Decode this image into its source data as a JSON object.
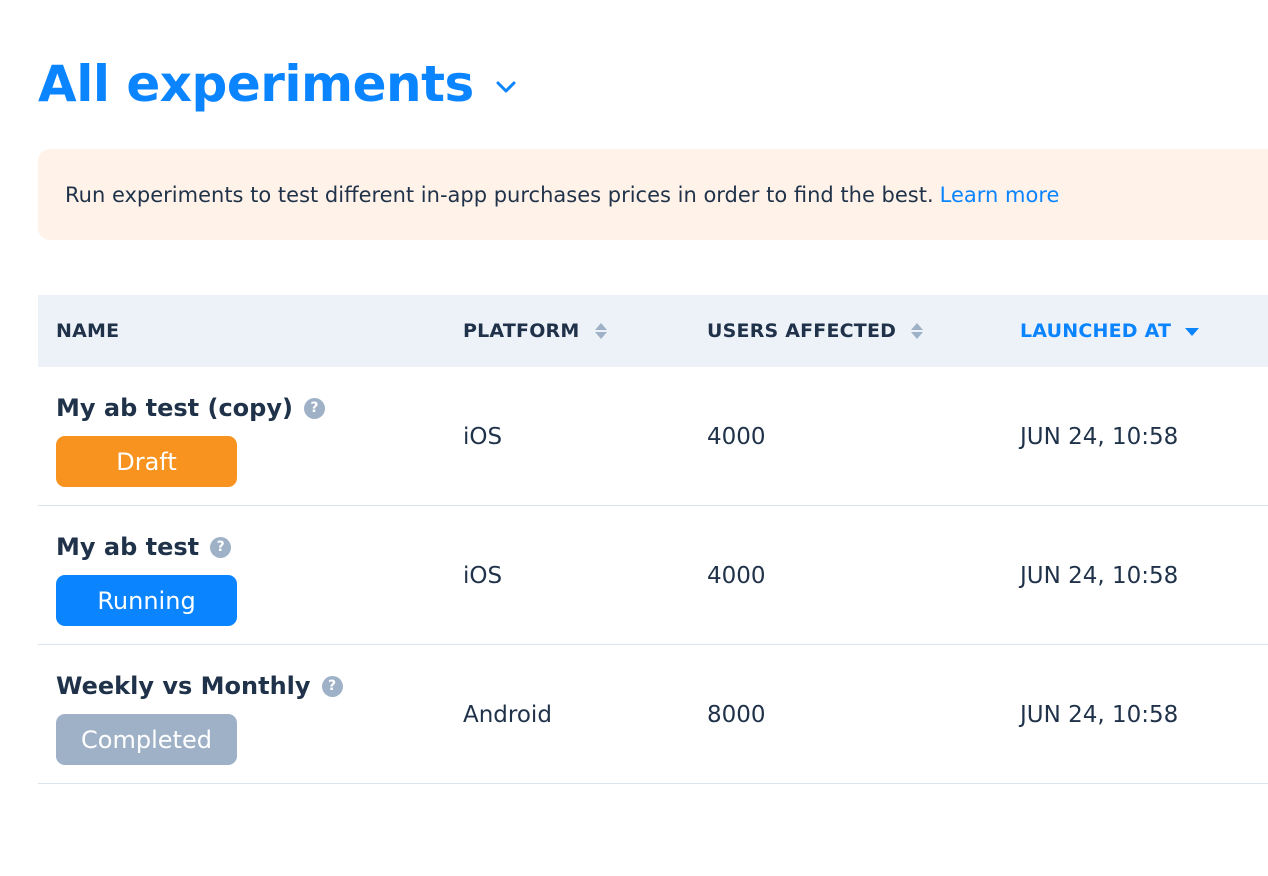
{
  "header": {
    "title": "All experiments",
    "dropdown_icon": "chevron-down-icon"
  },
  "banner": {
    "text": "Run experiments to test different in-app purchases prices in order to find the best.",
    "link_label": "Learn more"
  },
  "table": {
    "columns": {
      "name": "NAME",
      "platform": "PLATFORM",
      "users_affected": "USERS AFFECTED",
      "launched_at": "LAUNCHED AT"
    },
    "active_sort": "launched_at",
    "rows": [
      {
        "name": "My ab test (copy)",
        "status": "Draft",
        "platform": "iOS",
        "users_affected": "4000",
        "launched_at": "JUN 24, 10:58"
      },
      {
        "name": "My ab test",
        "status": "Running",
        "platform": "iOS",
        "users_affected": "4000",
        "launched_at": "JUN 24, 10:58"
      },
      {
        "name": "Weekly vs Monthly",
        "status": "Completed",
        "platform": "Android",
        "users_affected": "8000",
        "launched_at": "JUN 24, 10:58"
      }
    ]
  },
  "colors": {
    "accent": "#0a84ff",
    "draft": "#f7931e",
    "running": "#0a84ff",
    "completed": "#9eb1c7",
    "banner_bg": "#fff2e8",
    "header_bg": "#edf2f9"
  }
}
